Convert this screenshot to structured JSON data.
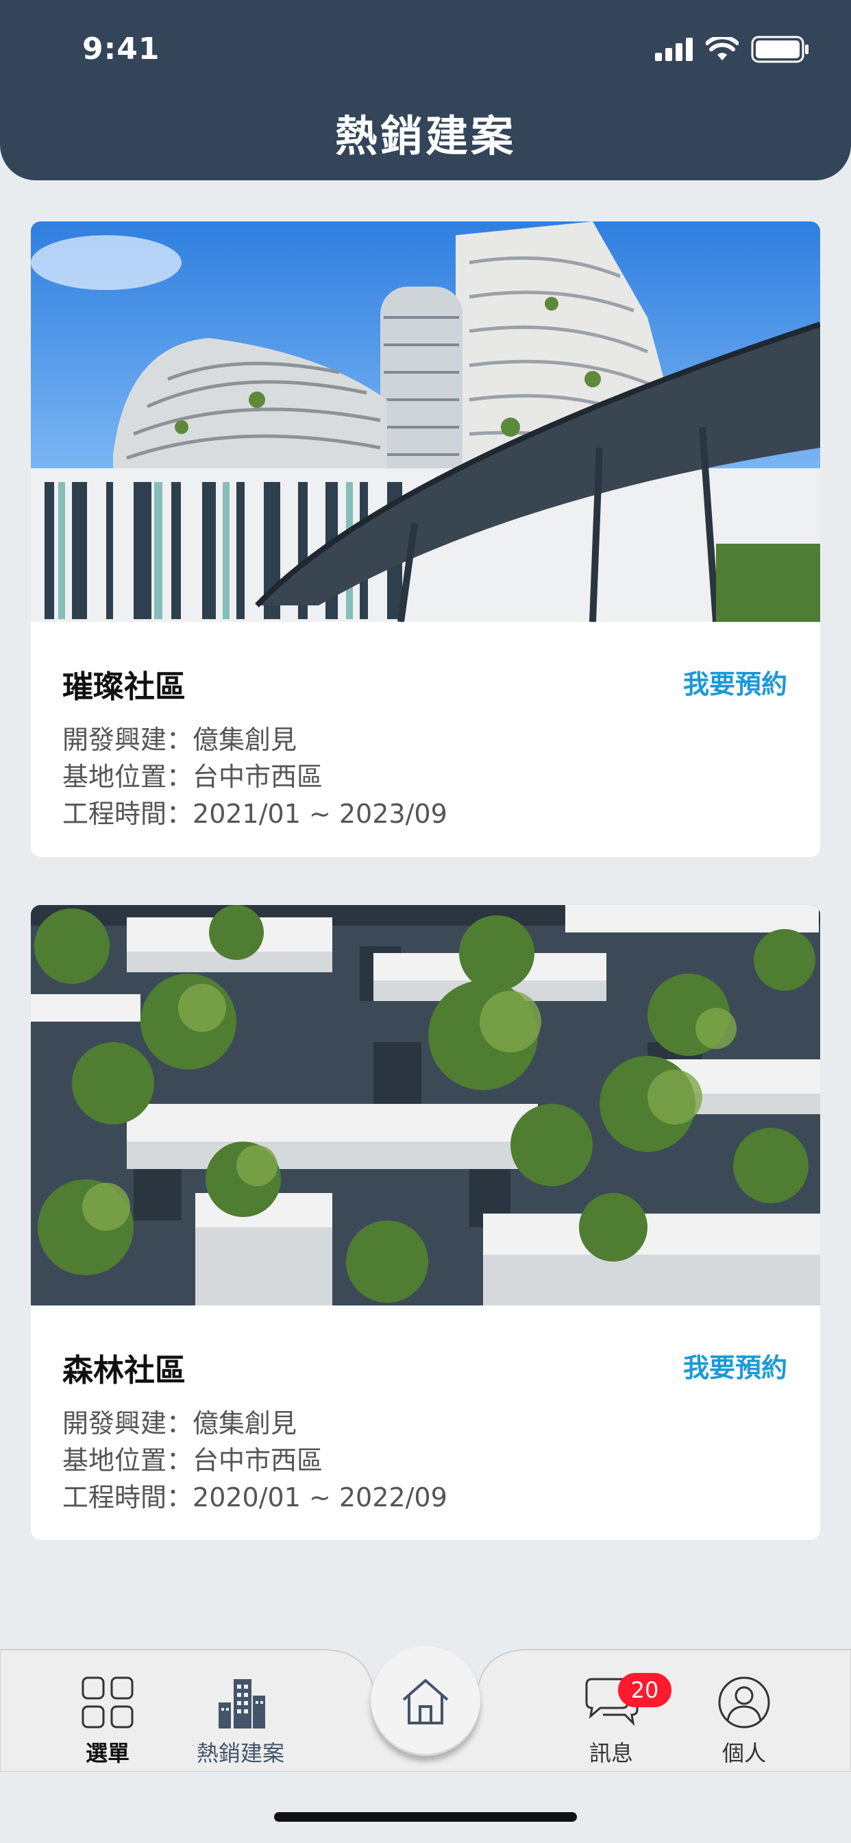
{
  "status": {
    "time": "9:41"
  },
  "header": {
    "title": "熱銷建案"
  },
  "projects": [
    {
      "name": "璀璨社區",
      "reserve": "我要預約",
      "developer_label": "開發興建：",
      "developer": "億集創見",
      "location_label": "基地位置：",
      "location": "台中市西區",
      "period_label": "工程時間：",
      "period": "2021/01 ~ 2023/09"
    },
    {
      "name": "森林社區",
      "reserve": "我要預約",
      "developer_label": "開發興建：",
      "developer": "億集創見",
      "location_label": "基地位置：",
      "location": "台中市西區",
      "period_label": "工程時間：",
      "period": "2020/01 ~ 2022/09"
    }
  ],
  "nav": {
    "menu": "選單",
    "hot": "熱銷建案",
    "messages": "訊息",
    "messages_badge": "20",
    "profile": "個人"
  },
  "colors": {
    "header": "#344559",
    "accent": "#1b9ad6",
    "badge": "#ff1a2e"
  }
}
